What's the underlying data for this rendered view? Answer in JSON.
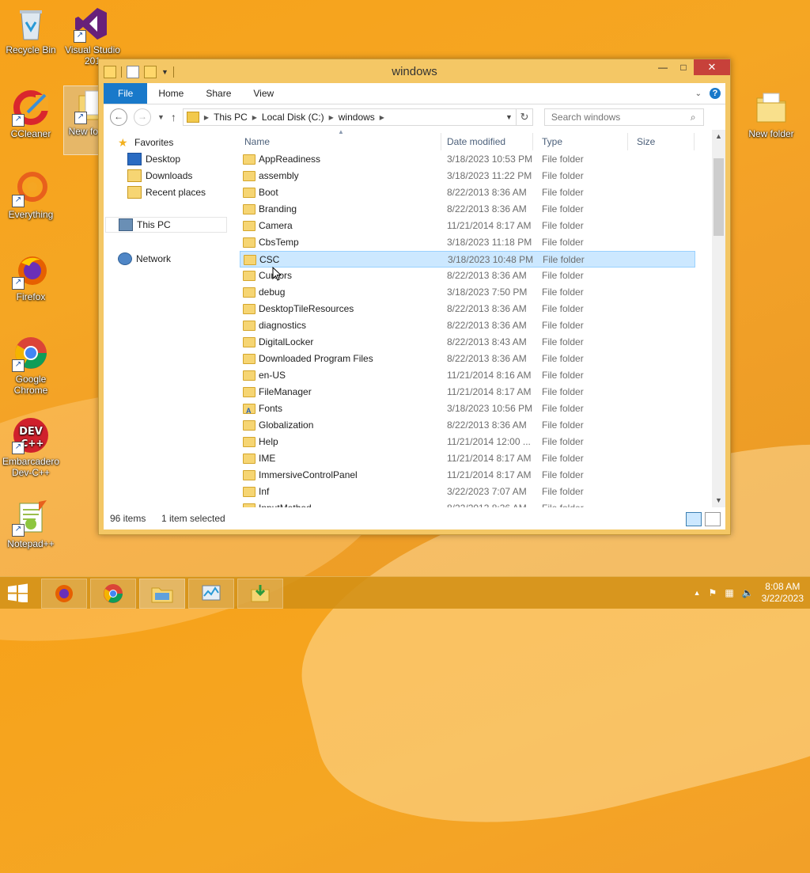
{
  "desktop": {
    "icons": [
      {
        "label": "Recycle Bin"
      },
      {
        "label": "Visual Studio 201"
      },
      {
        "label": "CCleaner"
      },
      {
        "label": "New fo Cop"
      },
      {
        "label": "Everything"
      },
      {
        "label": "Firefox"
      },
      {
        "label": "Google Chrome"
      },
      {
        "label": "Embarcadero Dev-C++"
      },
      {
        "label": "Notepad++"
      },
      {
        "label": "New folder"
      }
    ]
  },
  "window": {
    "title": "windows",
    "ribbon_tabs": [
      "File",
      "Home",
      "Share",
      "View"
    ],
    "breadcrumb": [
      "This PC",
      "Local Disk (C:)",
      "windows"
    ],
    "search_placeholder": "Search windows",
    "nav": {
      "favorites": "Favorites",
      "desktop": "Desktop",
      "downloads": "Downloads",
      "recent": "Recent places",
      "this_pc": "This PC",
      "network": "Network"
    },
    "columns": [
      "Name",
      "Date modified",
      "Type",
      "Size"
    ],
    "files": [
      {
        "name": "AppReadiness",
        "date": "3/18/2023 10:53 PM",
        "type": "File folder"
      },
      {
        "name": "assembly",
        "date": "3/18/2023 11:22 PM",
        "type": "File folder"
      },
      {
        "name": "Boot",
        "date": "8/22/2013 8:36 AM",
        "type": "File folder"
      },
      {
        "name": "Branding",
        "date": "8/22/2013 8:36 AM",
        "type": "File folder"
      },
      {
        "name": "Camera",
        "date": "11/21/2014 8:17 AM",
        "type": "File folder"
      },
      {
        "name": "CbsTemp",
        "date": "3/18/2023 11:18 PM",
        "type": "File folder"
      },
      {
        "name": "CSC",
        "date": "3/18/2023 10:48 PM",
        "type": "File folder"
      },
      {
        "name": "Cursors",
        "date": "8/22/2013 8:36 AM",
        "type": "File folder"
      },
      {
        "name": "debug",
        "date": "3/18/2023 7:50 PM",
        "type": "File folder"
      },
      {
        "name": "DesktopTileResources",
        "date": "8/22/2013 8:36 AM",
        "type": "File folder"
      },
      {
        "name": "diagnostics",
        "date": "8/22/2013 8:36 AM",
        "type": "File folder"
      },
      {
        "name": "DigitalLocker",
        "date": "8/22/2013 8:43 AM",
        "type": "File folder"
      },
      {
        "name": "Downloaded Program Files",
        "date": "8/22/2013 8:36 AM",
        "type": "File folder"
      },
      {
        "name": "en-US",
        "date": "11/21/2014 8:16 AM",
        "type": "File folder"
      },
      {
        "name": "FileManager",
        "date": "11/21/2014 8:17 AM",
        "type": "File folder"
      },
      {
        "name": "Fonts",
        "date": "3/18/2023 10:56 PM",
        "type": "File folder"
      },
      {
        "name": "Globalization",
        "date": "8/22/2013 8:36 AM",
        "type": "File folder"
      },
      {
        "name": "Help",
        "date": "11/21/2014 12:00 ...",
        "type": "File folder"
      },
      {
        "name": "IME",
        "date": "11/21/2014 8:17 AM",
        "type": "File folder"
      },
      {
        "name": "ImmersiveControlPanel",
        "date": "11/21/2014 8:17 AM",
        "type": "File folder"
      },
      {
        "name": "Inf",
        "date": "3/22/2023 7:07 AM",
        "type": "File folder"
      },
      {
        "name": "InputMethod",
        "date": "8/22/2013 8:36 AM",
        "type": "File folder"
      }
    ],
    "selected_index": 6,
    "status": {
      "count": "96 items",
      "selection": "1 item selected"
    }
  },
  "taskbar": {
    "time": "8:08 AM",
    "date": "3/22/2023"
  }
}
